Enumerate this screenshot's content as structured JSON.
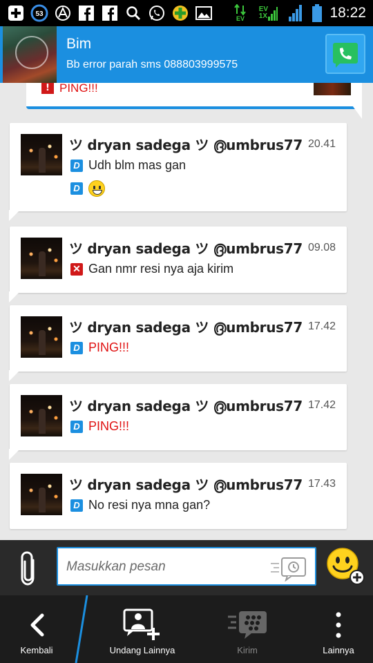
{
  "status_bar": {
    "notification_count": "53",
    "time": "18:22",
    "network_labels": [
      "EV",
      "EV",
      "1X"
    ]
  },
  "header": {
    "title": "Bim",
    "subtitle": "Bb error parah sms 088803999575"
  },
  "top_partial": {
    "text": "PING!!!"
  },
  "messages": [
    {
      "sender": "ツ dryan sadega ツ ൫umbrus77",
      "time": "20.41",
      "lines": [
        {
          "status": "D",
          "text": "Udh blm mas gan"
        },
        {
          "status": "D",
          "text": ""
        }
      ],
      "has_emoji": true
    },
    {
      "sender": "ツ dryan sadega ツ ൫umbrus77",
      "time": "09.08",
      "lines": [
        {
          "status": "X",
          "text": "Gan nmr resi nya aja kirim"
        }
      ]
    },
    {
      "sender": "ツ dryan sadega ツ ൫umbrus77",
      "time": "17.42",
      "lines": [
        {
          "status": "D",
          "text": "PING!!!"
        }
      ]
    },
    {
      "sender": "ツ dryan sadega ツ ൫umbrus77",
      "time": "17.42",
      "lines": [
        {
          "status": "D",
          "text": "PING!!!"
        }
      ]
    },
    {
      "sender": "ツ dryan sadega ツ ൫umbrus77",
      "time": "17.43",
      "lines": [
        {
          "status": "D",
          "text": "No resi nya mna gan?"
        }
      ]
    }
  ],
  "composer": {
    "placeholder": "Masukkan pesan"
  },
  "bottom_nav": {
    "back": "Kembali",
    "invite": "Undang Lainnya",
    "send": "Kirim",
    "more": "Lainnya"
  },
  "colors": {
    "accent": "#1b8fe0",
    "ping": "#e01010"
  }
}
